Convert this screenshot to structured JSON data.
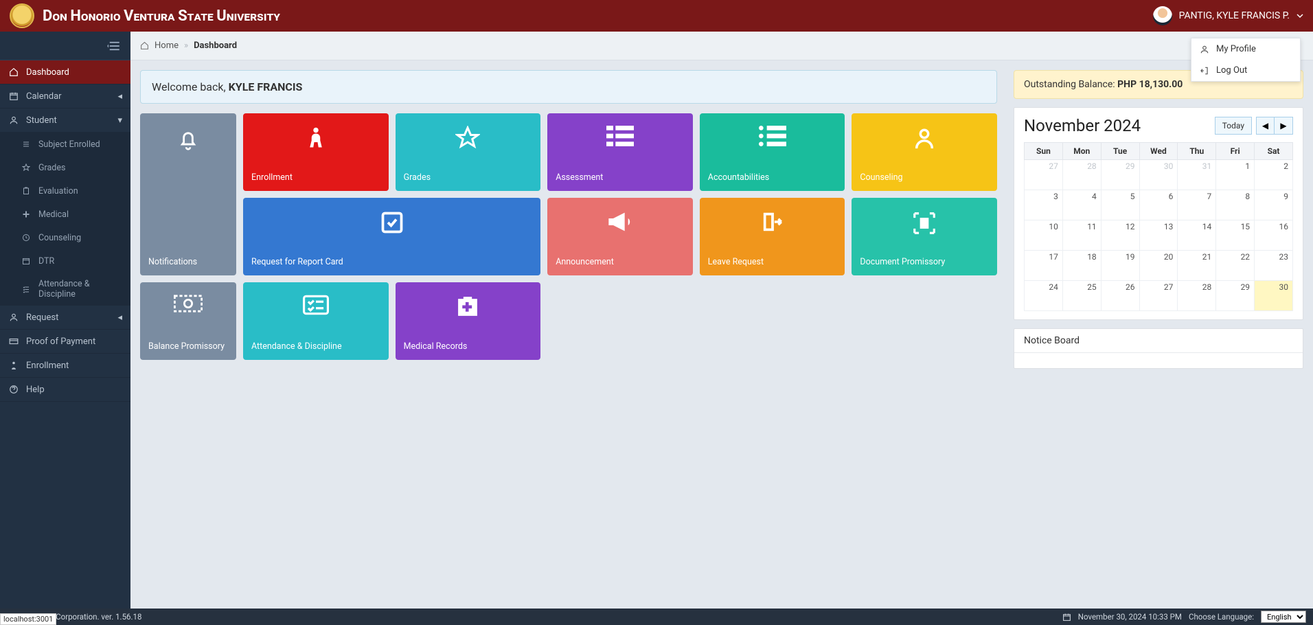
{
  "header": {
    "university_name_html": "Don Honorio Ventura State University",
    "user_name": "PANTIG, KYLE FRANCIS P."
  },
  "user_menu": {
    "profile": "My Profile",
    "logout": "Log Out"
  },
  "breadcrumb": {
    "home": "Home",
    "current": "Dashboard"
  },
  "sidebar": {
    "dashboard": "Dashboard",
    "calendar": "Calendar",
    "student": "Student",
    "student_sub": {
      "subject_enrolled": "Subject Enrolled",
      "grades": "Grades",
      "evaluation": "Evaluation",
      "medical": "Medical",
      "counseling": "Counseling",
      "dtr": "DTR",
      "attendance": "Attendance & Discipline"
    },
    "request": "Request",
    "proof_of_payment": "Proof of Payment",
    "enrollment": "Enrollment",
    "help": "Help"
  },
  "welcome": {
    "prefix": "Welcome back, ",
    "name": "KYLE FRANCIS"
  },
  "cards": {
    "notifications": "Notifications",
    "enrollment": "Enrollment",
    "grades": "Grades",
    "assessment": "Assessment",
    "accountabilities": "Accountabilities",
    "counseling": "Counseling",
    "reqreport": "Request for Report Card",
    "announcement": "Announcement",
    "leave": "Leave Request",
    "docprom": "Document Promissory",
    "balprom": "Balance Promissory",
    "attdisc": "Attendance & Discipline",
    "medrec": "Medical Records"
  },
  "balance": {
    "label": "Outstanding Balance: ",
    "amount": "PHP 18,130.00"
  },
  "calendar": {
    "title": "November 2024",
    "today": "Today",
    "dow": [
      "Sun",
      "Mon",
      "Tue",
      "Wed",
      "Thu",
      "Fri",
      "Sat"
    ],
    "rows": [
      [
        {
          "n": "27",
          "o": true
        },
        {
          "n": "28",
          "o": true
        },
        {
          "n": "29",
          "o": true
        },
        {
          "n": "30",
          "o": true
        },
        {
          "n": "31",
          "o": true
        },
        {
          "n": "1"
        },
        {
          "n": "2"
        }
      ],
      [
        {
          "n": "3"
        },
        {
          "n": "4"
        },
        {
          "n": "5"
        },
        {
          "n": "6"
        },
        {
          "n": "7"
        },
        {
          "n": "8"
        },
        {
          "n": "9"
        }
      ],
      [
        {
          "n": "10"
        },
        {
          "n": "11"
        },
        {
          "n": "12"
        },
        {
          "n": "13"
        },
        {
          "n": "14"
        },
        {
          "n": "15"
        },
        {
          "n": "16"
        }
      ],
      [
        {
          "n": "17"
        },
        {
          "n": "18"
        },
        {
          "n": "19"
        },
        {
          "n": "20"
        },
        {
          "n": "21"
        },
        {
          "n": "22"
        },
        {
          "n": "23"
        }
      ],
      [
        {
          "n": "24"
        },
        {
          "n": "25"
        },
        {
          "n": "26"
        },
        {
          "n": "27"
        },
        {
          "n": "28"
        },
        {
          "n": "29"
        },
        {
          "n": "30",
          "t": true
        }
      ]
    ]
  },
  "notice_board": {
    "title": "Notice Board"
  },
  "footer": {
    "company": "Technologies Corporation. ver. 1.56.18",
    "datetime": "November 30, 2024 10:33 PM",
    "lang_label": "Choose Language:",
    "lang_value": "English"
  },
  "localhost": "localhost:3001"
}
